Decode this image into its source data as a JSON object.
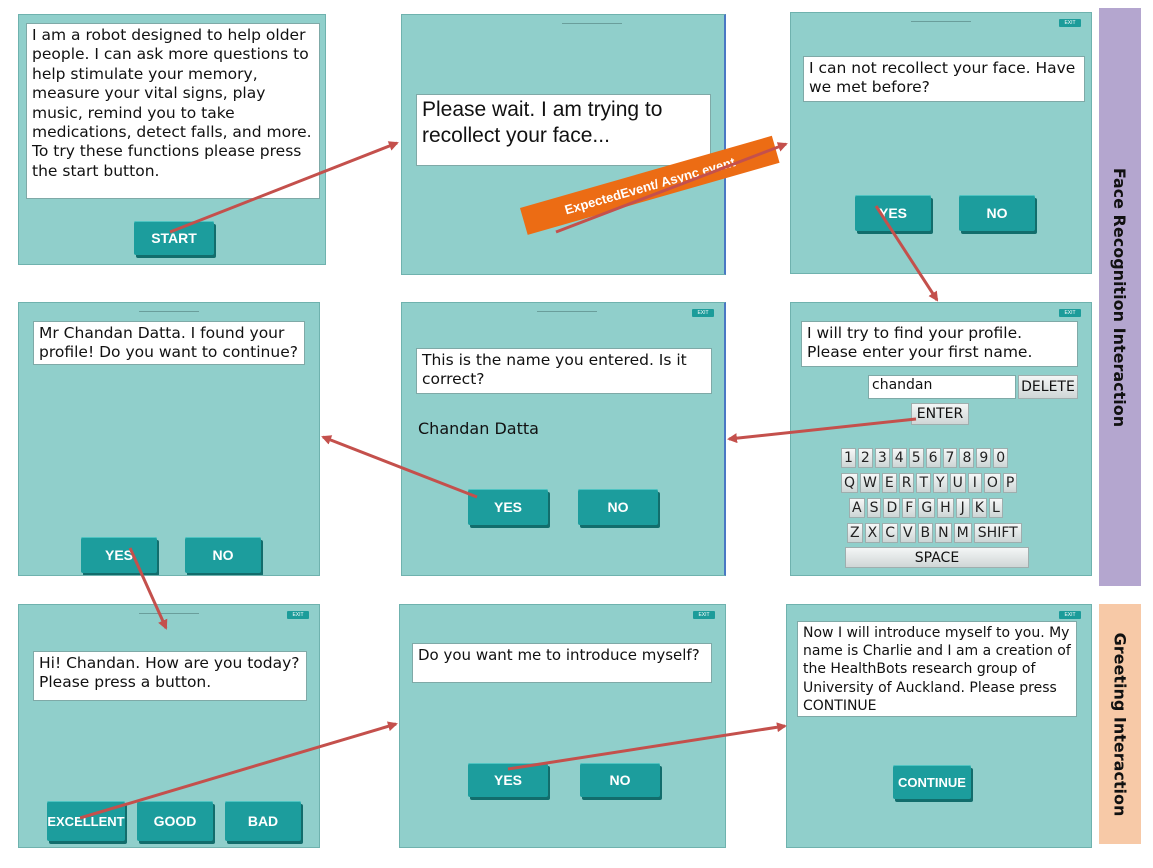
{
  "sections": {
    "face_recognition": "Face Recognition Interaction",
    "greeting": "Greeting Interaction",
    "async_label": "ExpectedEvent/ Async event"
  },
  "colors": {
    "screen_bg": "#90cfcb",
    "button": "#1c9d9d",
    "arrow": "#c4504c",
    "face_panel": "#b4a6cf",
    "greeting_panel": "#f7c9a7",
    "badge": "#ec6c14"
  },
  "screens": {
    "intro": {
      "message": "I am a robot designed to help older people. I can ask more questions to help stimulate your memory, measure your vital signs, play music, remind you to take medications, detect falls, and more. To try these functions please press the start button.",
      "start": "START"
    },
    "wait": {
      "message": "Please wait. I am trying to recollect your face..."
    },
    "recollect": {
      "message": "I can not recollect your face. Have we met before?",
      "yes": "YES",
      "no": "NO",
      "exit": "EXIT"
    },
    "profile": {
      "message": "I will try to find your profile. Please enter your first name.",
      "input": "chandan",
      "delete": "DELETE",
      "enter": "ENTER",
      "space": "SPACE",
      "exit": "EXIT"
    },
    "confirm_name": {
      "message": "This is the name you entered. Is it correct?",
      "name": "Chandan Datta",
      "yes": "YES",
      "no": "NO",
      "exit": "EXIT"
    },
    "found": {
      "message": "Mr Chandan Datta. I found your profile! Do you want to continue?",
      "yes": "YES",
      "no": "NO"
    },
    "greet": {
      "message": "Hi! Chandan. How are you today? Please press a button.",
      "excellent": "EXCELLENT",
      "good": "GOOD",
      "bad": "BAD",
      "exit": "EXIT"
    },
    "introduce": {
      "message": "Do you want me to introduce myself?",
      "yes": "YES",
      "no": "NO",
      "exit": "EXIT"
    },
    "intro_self": {
      "message": "Now I will introduce myself to you. My name is Charlie and I am a creation of the HealthBots research group of University of Auckland. Please press CONTINUE",
      "continue": "CONTINUE",
      "exit": "EXIT"
    }
  },
  "keyboard": {
    "row1": [
      "1",
      "2",
      "3",
      "4",
      "5",
      "6",
      "7",
      "8",
      "9",
      "0"
    ],
    "row2": [
      "Q",
      "W",
      "E",
      "R",
      "T",
      "Y",
      "U",
      "I",
      "O",
      "P"
    ],
    "row3": [
      "A",
      "S",
      "D",
      "F",
      "G",
      "H",
      "J",
      "K",
      "L"
    ],
    "row4": [
      "Z",
      "X",
      "C",
      "V",
      "B",
      "N",
      "M",
      "SHIFT"
    ]
  }
}
